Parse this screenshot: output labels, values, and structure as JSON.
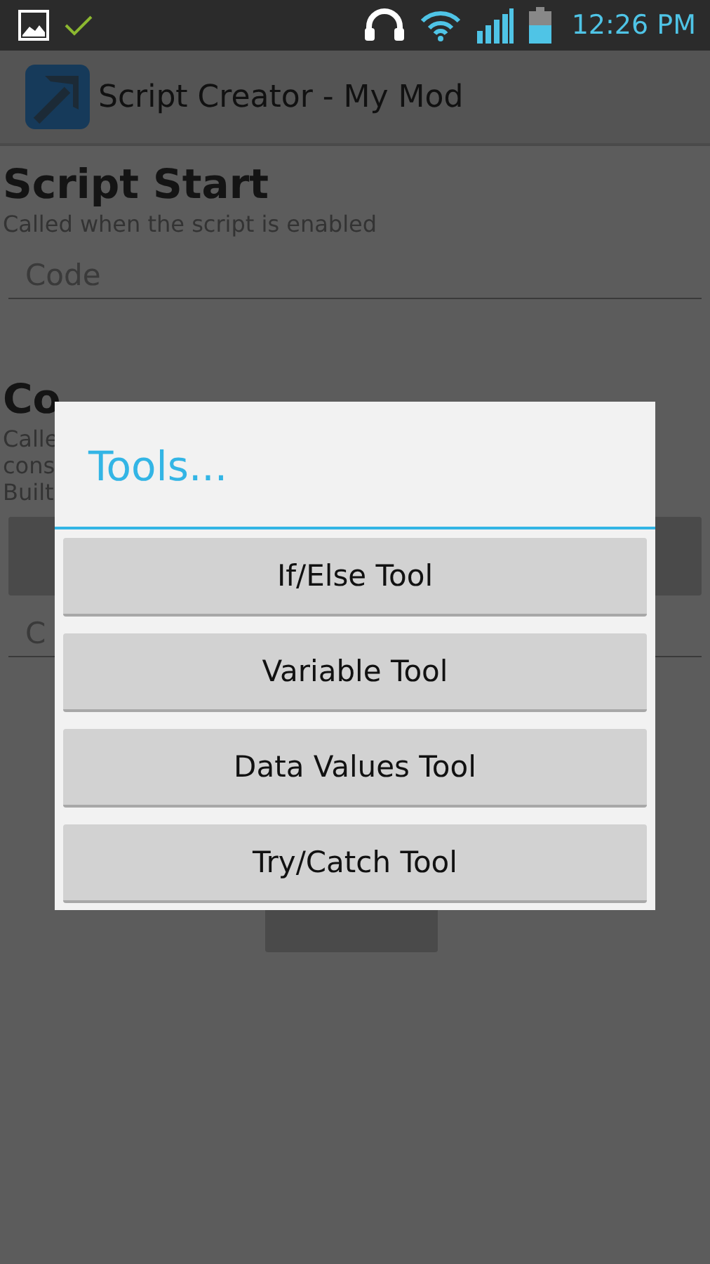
{
  "status_bar": {
    "time": "12:26 PM"
  },
  "action_bar": {
    "title": "Script Creator - My Mod"
  },
  "sections": [
    {
      "heading": "Script Start",
      "description_lines": [
        "Called when the script is enabled"
      ],
      "field": {
        "placeholder": "Code"
      },
      "has_button": false
    },
    {
      "heading": "Co",
      "description_lines": [
        "Calle",
        "cons",
        "Built"
      ],
      "field": {
        "placeholder": "C"
      },
      "has_button": true
    }
  ],
  "dialog": {
    "title": "Tools...",
    "buttons": [
      "If/Else Tool",
      "Variable Tool",
      "Data Values Tool",
      "Try/Catch Tool"
    ]
  }
}
